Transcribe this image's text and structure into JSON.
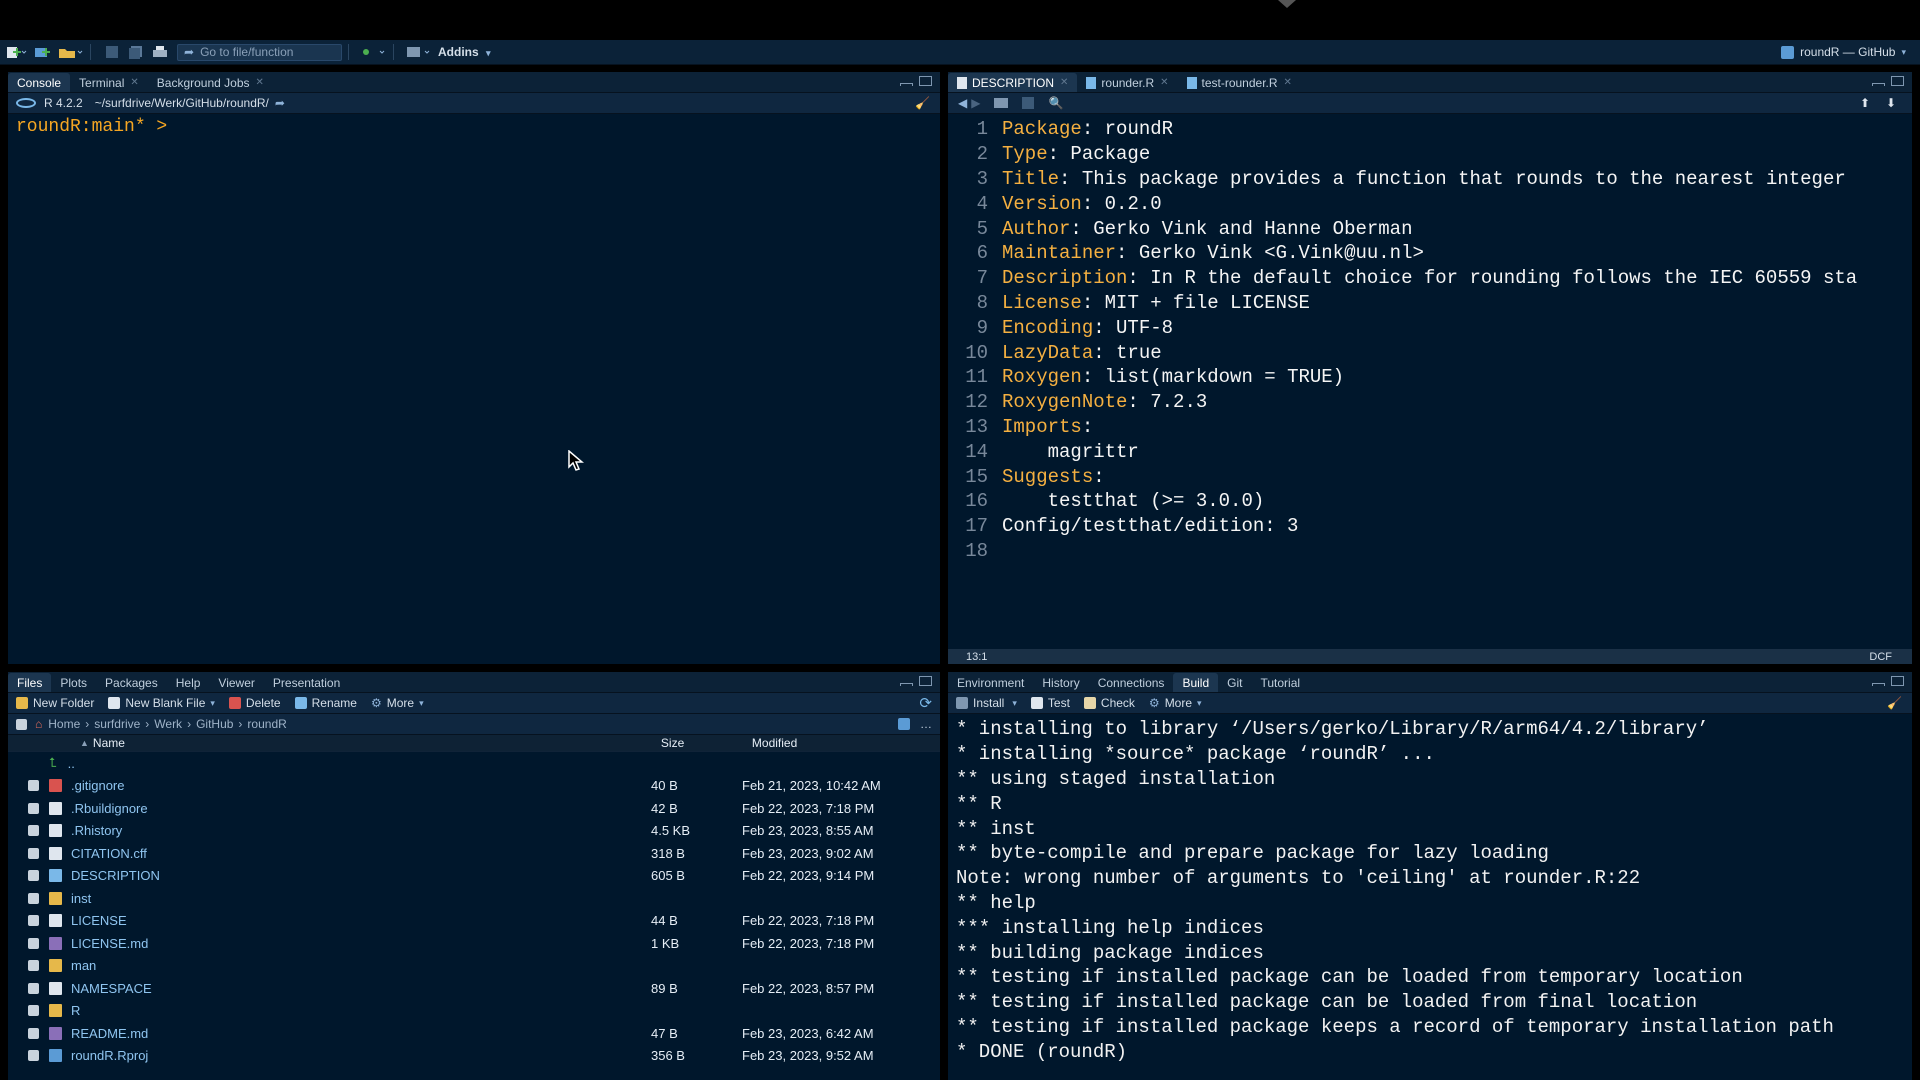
{
  "toolbar": {
    "goto_placeholder": "Go to file/function",
    "addins_label": "Addins",
    "project_label": "roundR — GitHub"
  },
  "console_pane": {
    "tabs": [
      {
        "label": "Console"
      },
      {
        "label": "Terminal"
      },
      {
        "label": "Background Jobs"
      }
    ],
    "r_version": "R 4.2.2",
    "path": "~/surfdrive/Werk/GitHub/roundR/",
    "prompt": "roundR:main* >"
  },
  "editor_pane": {
    "tabs": [
      {
        "label": "DESCRIPTION"
      },
      {
        "label": "rounder.R"
      },
      {
        "label": "test-rounder.R"
      }
    ],
    "lines": [
      {
        "num": "1",
        "key": "Package",
        "sep": ": ",
        "val": "roundR"
      },
      {
        "num": "2",
        "key": "Type",
        "sep": ": ",
        "val": "Package"
      },
      {
        "num": "3",
        "key": "Title",
        "sep": ": ",
        "val": "This package provides a function that rounds to the nearest integer"
      },
      {
        "num": "4",
        "key": "Version",
        "sep": ": ",
        "val": "0.2.0"
      },
      {
        "num": "5",
        "key": "Author",
        "sep": ": ",
        "val": "Gerko Vink and Hanne Oberman"
      },
      {
        "num": "6",
        "key": "Maintainer",
        "sep": ": ",
        "val": "Gerko Vink <G.Vink@uu.nl>"
      },
      {
        "num": "7",
        "key": "Description",
        "sep": ": ",
        "val": "In R the default choice for rounding follows the IEC 60559 sta"
      },
      {
        "num": "8",
        "key": "License",
        "sep": ": ",
        "val": "MIT + file LICENSE"
      },
      {
        "num": "9",
        "key": "Encoding",
        "sep": ": ",
        "val": "UTF-8"
      },
      {
        "num": "10",
        "key": "LazyData",
        "sep": ": ",
        "val": "true"
      },
      {
        "num": "11",
        "key": "Roxygen",
        "sep": ": ",
        "val": "list(markdown = TRUE)"
      },
      {
        "num": "12",
        "key": "RoxygenNote",
        "sep": ": ",
        "val": "7.2.3"
      },
      {
        "num": "13",
        "key": "Imports",
        "sep": ":",
        "val": ""
      },
      {
        "num": "14",
        "key": "",
        "sep": "",
        "val": "    magrittr"
      },
      {
        "num": "15",
        "key": "Suggests",
        "sep": ":",
        "val": ""
      },
      {
        "num": "16",
        "key": "",
        "sep": "",
        "val": "    testthat (>= 3.0.0)"
      },
      {
        "num": "17",
        "key": "",
        "sep": "",
        "val": "Config/testthat/edition: 3"
      },
      {
        "num": "18",
        "key": "",
        "sep": "",
        "val": ""
      }
    ],
    "cursor_pos": "13:1",
    "file_type": "DCF"
  },
  "files_pane": {
    "tabs": [
      {
        "label": "Files"
      },
      {
        "label": "Plots"
      },
      {
        "label": "Packages"
      },
      {
        "label": "Help"
      },
      {
        "label": "Viewer"
      },
      {
        "label": "Presentation"
      }
    ],
    "toolbar": {
      "new_folder": "New Folder",
      "new_blank_file": "New Blank File",
      "delete": "Delete",
      "rename": "Rename",
      "more": "More"
    },
    "breadcrumb": [
      "Home",
      "surfdrive",
      "Werk",
      "GitHub",
      "roundR"
    ],
    "columns": {
      "name": "Name",
      "size": "Size",
      "modified": "Modified"
    },
    "up_label": "..",
    "rows": [
      {
        "name": ".gitignore",
        "size": "40 B",
        "modified": "Feb 21, 2023, 10:42 AM",
        "icon": "gitignore-file-icon",
        "color": "#d9534f"
      },
      {
        "name": ".Rbuildignore",
        "size": "42 B",
        "modified": "Feb 22, 2023, 7:18 PM",
        "icon": "text-file-icon",
        "color": "#dfe6ee"
      },
      {
        "name": ".Rhistory",
        "size": "4.5 KB",
        "modified": "Feb 23, 2023, 8:55 AM",
        "icon": "history-file-icon",
        "color": "#dfe6ee"
      },
      {
        "name": "CITATION.cff",
        "size": "318 B",
        "modified": "Feb 23, 2023, 9:02 AM",
        "icon": "text-file-icon",
        "color": "#dfe6ee"
      },
      {
        "name": "DESCRIPTION",
        "size": "605 B",
        "modified": "Feb 22, 2023, 9:14 PM",
        "icon": "description-file-icon",
        "color": "#7ab8e8"
      },
      {
        "name": "inst",
        "size": "",
        "modified": "",
        "icon": "folder-icon",
        "color": "#e6b84a"
      },
      {
        "name": "LICENSE",
        "size": "44 B",
        "modified": "Feb 22, 2023, 7:18 PM",
        "icon": "text-file-icon",
        "color": "#dfe6ee"
      },
      {
        "name": "LICENSE.md",
        "size": "1 KB",
        "modified": "Feb 22, 2023, 7:18 PM",
        "icon": "markdown-file-icon",
        "color": "#8a6fb8"
      },
      {
        "name": "man",
        "size": "",
        "modified": "",
        "icon": "folder-icon",
        "color": "#e6b84a"
      },
      {
        "name": "NAMESPACE",
        "size": "89 B",
        "modified": "Feb 22, 2023, 8:57 PM",
        "icon": "text-file-icon",
        "color": "#dfe6ee"
      },
      {
        "name": "R",
        "size": "",
        "modified": "",
        "icon": "folder-icon",
        "color": "#e6b84a"
      },
      {
        "name": "README.md",
        "size": "47 B",
        "modified": "Feb 23, 2023, 6:42 AM",
        "icon": "markdown-file-icon",
        "color": "#8a6fb8"
      },
      {
        "name": "roundR.Rproj",
        "size": "356 B",
        "modified": "Feb 23, 2023, 9:52 AM",
        "icon": "rproj-file-icon",
        "color": "#5b9bd5"
      }
    ]
  },
  "build_pane": {
    "tabs": [
      {
        "label": "Environment"
      },
      {
        "label": "History"
      },
      {
        "label": "Connections"
      },
      {
        "label": "Build"
      },
      {
        "label": "Git"
      },
      {
        "label": "Tutorial"
      }
    ],
    "toolbar": {
      "install": "Install",
      "test": "Test",
      "check": "Check",
      "more": "More"
    },
    "lines": [
      "* installing to library ‘/Users/gerko/Library/R/arm64/4.2/library’",
      "* installing *source* package ‘roundR’ ...",
      "** using staged installation",
      "** R",
      "** inst",
      "** byte-compile and prepare package for lazy loading",
      "Note: wrong number of arguments to 'ceiling' at rounder.R:22",
      "** help",
      "*** installing help indices",
      "** building package indices",
      "** testing if installed package can be loaded from temporary location",
      "** testing if installed package can be loaded from final location",
      "** testing if installed package keeps a record of temporary installation path",
      "* DONE (roundR)"
    ]
  }
}
